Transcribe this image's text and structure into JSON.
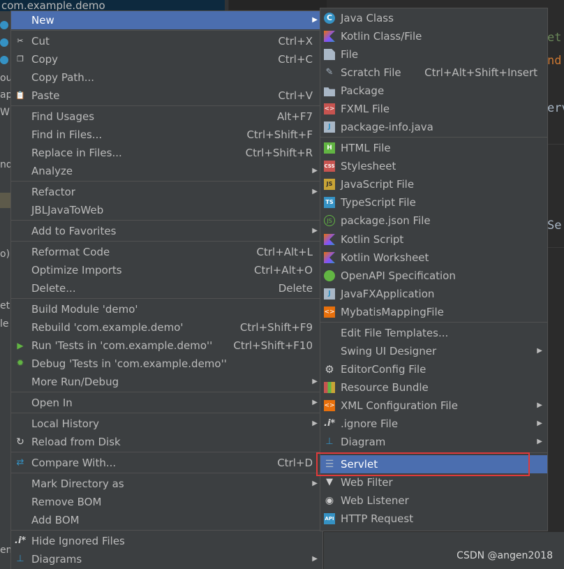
{
  "background": {
    "project_selected_text": "com.example.demo",
    "side_fragments": [
      "ou",
      "ap",
      "WE",
      "nd",
      "o)",
      "et",
      "le",
      "em"
    ],
    "editor_fragments": [
      "et",
      "nd",
      "erv",
      "Se"
    ],
    "watermark": "CSDN @angen2018"
  },
  "main_menu": {
    "items": [
      {
        "label": "New",
        "shortcut": "",
        "icon": "",
        "submenu": true,
        "selected": true
      },
      {
        "label": "Cut",
        "shortcut": "Ctrl+X",
        "icon": "scissors-icon",
        "submenu": false
      },
      {
        "label": "Copy",
        "shortcut": "Ctrl+C",
        "icon": "copy-icon",
        "submenu": false
      },
      {
        "label": "Copy Path...",
        "shortcut": "",
        "icon": "",
        "submenu": false
      },
      {
        "label": "Paste",
        "shortcut": "Ctrl+V",
        "icon": "paste-icon",
        "submenu": false
      },
      {
        "label": "Find Usages",
        "shortcut": "Alt+F7",
        "icon": "",
        "submenu": false
      },
      {
        "label": "Find in Files...",
        "shortcut": "Ctrl+Shift+F",
        "icon": "",
        "submenu": false
      },
      {
        "label": "Replace in Files...",
        "shortcut": "Ctrl+Shift+R",
        "icon": "",
        "submenu": false
      },
      {
        "label": "Analyze",
        "shortcut": "",
        "icon": "",
        "submenu": true
      },
      {
        "label": "Refactor",
        "shortcut": "",
        "icon": "",
        "submenu": true
      },
      {
        "label": "JBLJavaToWeb",
        "shortcut": "",
        "icon": "",
        "submenu": false
      },
      {
        "label": "Add to Favorites",
        "shortcut": "",
        "icon": "",
        "submenu": true
      },
      {
        "label": "Reformat Code",
        "shortcut": "Ctrl+Alt+L",
        "icon": "",
        "submenu": false
      },
      {
        "label": "Optimize Imports",
        "shortcut": "Ctrl+Alt+O",
        "icon": "",
        "submenu": false
      },
      {
        "label": "Delete...",
        "shortcut": "Delete",
        "icon": "",
        "submenu": false
      },
      {
        "label": "Build Module 'demo'",
        "shortcut": "",
        "icon": "",
        "submenu": false
      },
      {
        "label": "Rebuild 'com.example.demo'",
        "shortcut": "Ctrl+Shift+F9",
        "icon": "",
        "submenu": false
      },
      {
        "label": "Run 'Tests in 'com.example.demo''",
        "shortcut": "Ctrl+Shift+F10",
        "icon": "run-icon",
        "submenu": false
      },
      {
        "label": "Debug 'Tests in 'com.example.demo''",
        "shortcut": "",
        "icon": "debug-icon",
        "submenu": false
      },
      {
        "label": "More Run/Debug",
        "shortcut": "",
        "icon": "",
        "submenu": true
      },
      {
        "label": "Open In",
        "shortcut": "",
        "icon": "",
        "submenu": true
      },
      {
        "label": "Local History",
        "shortcut": "",
        "icon": "",
        "submenu": true
      },
      {
        "label": "Reload from Disk",
        "shortcut": "",
        "icon": "reload-icon",
        "submenu": false
      },
      {
        "label": "Compare With...",
        "shortcut": "Ctrl+D",
        "icon": "compare-icon",
        "submenu": false
      },
      {
        "label": "Mark Directory as",
        "shortcut": "",
        "icon": "",
        "submenu": true
      },
      {
        "label": "Remove BOM",
        "shortcut": "",
        "icon": "",
        "submenu": false
      },
      {
        "label": "Add BOM",
        "shortcut": "",
        "icon": "",
        "submenu": false
      },
      {
        "label": "Hide Ignored Files",
        "shortcut": "",
        "icon": "ignore-icon",
        "submenu": false
      },
      {
        "label": "Diagrams",
        "shortcut": "",
        "icon": "diagram-icon",
        "submenu": true
      }
    ]
  },
  "new_submenu": {
    "items": [
      {
        "label": "Java Class",
        "shortcut": "",
        "icon": "java-class-icon",
        "submenu": false
      },
      {
        "label": "Kotlin Class/File",
        "shortcut": "",
        "icon": "kotlin-icon",
        "submenu": false
      },
      {
        "label": "File",
        "shortcut": "",
        "icon": "file-icon",
        "submenu": false
      },
      {
        "label": "Scratch File",
        "shortcut": "Ctrl+Alt+Shift+Insert",
        "icon": "scratch-file-icon",
        "submenu": false
      },
      {
        "label": "Package",
        "shortcut": "",
        "icon": "package-icon",
        "submenu": false
      },
      {
        "label": "FXML File",
        "shortcut": "",
        "icon": "fxml-icon",
        "submenu": false
      },
      {
        "label": "package-info.java",
        "shortcut": "",
        "icon": "java-file-icon",
        "submenu": false
      },
      {
        "label": "HTML File",
        "shortcut": "",
        "icon": "html-icon",
        "submenu": false
      },
      {
        "label": "Stylesheet",
        "shortcut": "",
        "icon": "css-icon",
        "submenu": false
      },
      {
        "label": "JavaScript File",
        "shortcut": "",
        "icon": "javascript-icon",
        "submenu": false
      },
      {
        "label": "TypeScript File",
        "shortcut": "",
        "icon": "typescript-icon",
        "submenu": false
      },
      {
        "label": "package.json File",
        "shortcut": "",
        "icon": "nodejs-icon",
        "submenu": false
      },
      {
        "label": "Kotlin Script",
        "shortcut": "",
        "icon": "kotlin-script-icon",
        "submenu": false
      },
      {
        "label": "Kotlin Worksheet",
        "shortcut": "",
        "icon": "kotlin-worksheet-icon",
        "submenu": false
      },
      {
        "label": "OpenAPI Specification",
        "shortcut": "",
        "icon": "openapi-icon",
        "submenu": false
      },
      {
        "label": "JavaFXApplication",
        "shortcut": "",
        "icon": "javafx-icon",
        "submenu": false
      },
      {
        "label": "MybatisMappingFile",
        "shortcut": "",
        "icon": "mybatis-icon",
        "submenu": false
      },
      {
        "label": "Edit File Templates...",
        "shortcut": "",
        "icon": "",
        "submenu": false
      },
      {
        "label": "Swing UI Designer",
        "shortcut": "",
        "icon": "",
        "submenu": true
      },
      {
        "label": "EditorConfig File",
        "shortcut": "",
        "icon": "gear-icon",
        "submenu": false
      },
      {
        "label": "Resource Bundle",
        "shortcut": "",
        "icon": "resource-bundle-icon",
        "submenu": false
      },
      {
        "label": "XML Configuration File",
        "shortcut": "",
        "icon": "xml-icon",
        "submenu": true
      },
      {
        "label": ".ignore File",
        "shortcut": "",
        "icon": "ignore-file-icon",
        "submenu": true
      },
      {
        "label": "Diagram",
        "shortcut": "",
        "icon": "diagram-icon",
        "submenu": true
      },
      {
        "label": "Servlet",
        "shortcut": "",
        "icon": "servlet-icon",
        "submenu": false,
        "selected": true,
        "outlined": true
      },
      {
        "label": "Web Filter",
        "shortcut": "",
        "icon": "filter-icon",
        "submenu": false
      },
      {
        "label": "Web Listener",
        "shortcut": "",
        "icon": "listener-icon",
        "submenu": false
      },
      {
        "label": "HTTP Request",
        "shortcut": "",
        "icon": "api-icon",
        "submenu": false
      }
    ]
  },
  "colors": {
    "menu_bg": "#3c3f41",
    "selection": "#4b6eaf",
    "highlight_outline": "#e03a3a",
    "editor_bg": "#2b2b2b"
  }
}
